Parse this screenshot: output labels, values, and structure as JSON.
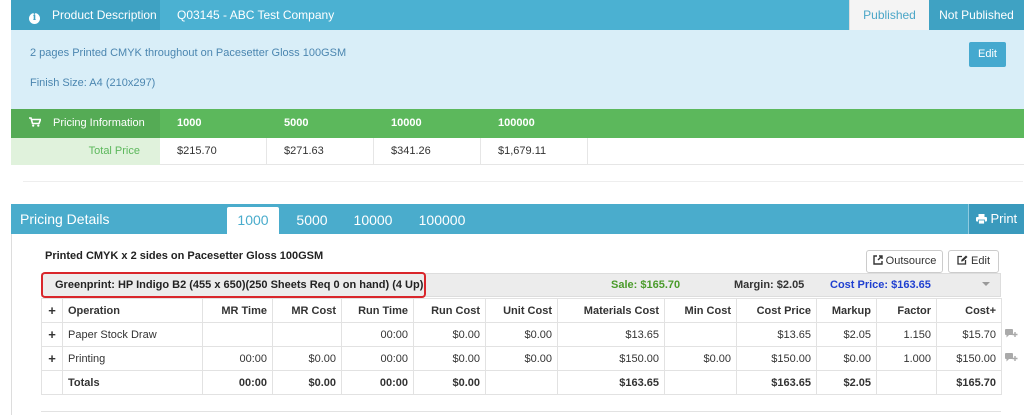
{
  "product": {
    "label": "Product Description",
    "title": "Q03145 - ABC Test Company",
    "published_label": "Published",
    "not_published_label": "Not Published",
    "description": "2 pages Printed CMYK throughout on Pacesetter Gloss 100GSM",
    "finish_size": "Finish Size: A4 (210x297)",
    "edit_label": "Edit"
  },
  "pricing_info": {
    "label": "Pricing Information",
    "quantities": [
      "1000",
      "5000",
      "10000",
      "100000"
    ],
    "total_label": "Total Price",
    "totals": [
      "$215.70",
      "$271.63",
      "$341.26",
      "$1,679.11"
    ]
  },
  "pricing_details": {
    "title": "Pricing Details",
    "tabs": [
      "1000",
      "5000",
      "10000",
      "100000"
    ],
    "active_tab": "1000",
    "print_label": "Print",
    "spec_title": "Printed CMYK x 2 sides on Pacesetter Gloss 100GSM",
    "outsource_label": "Outsource",
    "edit_label": "Edit",
    "press": {
      "name": "Greenprint: HP Indigo B2 (455 x 650)(250 Sheets Req 0 on hand) (4 Up)",
      "sale": "Sale: $165.70",
      "margin": "Margin: $2.05",
      "cost_price": "Cost Price: $163.65"
    },
    "table": {
      "headers": [
        "",
        "Operation",
        "MR Time",
        "MR Cost",
        "Run Time",
        "Run Cost",
        "Unit Cost",
        "Materials Cost",
        "Min Cost",
        "Cost Price",
        "Markup",
        "Factor",
        "Cost+"
      ],
      "rows": [
        [
          "+",
          "Paper Stock Draw",
          "",
          "",
          "00:00",
          "$0.00",
          "$0.00",
          "$13.65",
          "",
          "$13.65",
          "$2.05",
          "1.150",
          "$15.70"
        ],
        [
          "+",
          "Printing",
          "00:00",
          "$0.00",
          "00:00",
          "$0.00",
          "$0.00",
          "$150.00",
          "$0.00",
          "$150.00",
          "$0.00",
          "1.000",
          "$150.00"
        ]
      ],
      "totals": [
        "",
        "Totals",
        "00:00",
        "$0.00",
        "00:00",
        "$0.00",
        "",
        "$163.65",
        "",
        "$163.65",
        "$2.05",
        "",
        "$165.70"
      ]
    }
  },
  "colors": {
    "header_blue": "#4bb1d2",
    "pricing_green": "#5cb85c",
    "highlight_red": "#d9262b",
    "cost_blue": "#1f3fd0",
    "sale_green": "#4a9b2a"
  }
}
